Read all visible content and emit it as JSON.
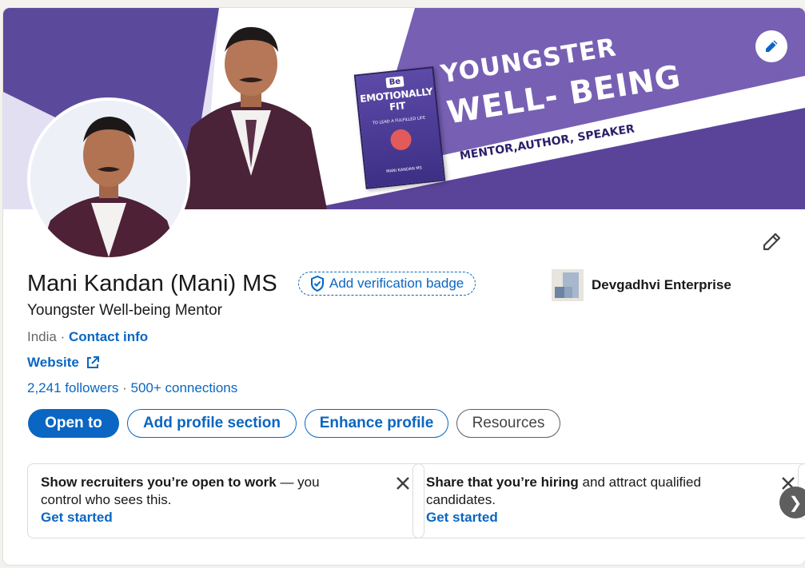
{
  "banner": {
    "title_line1": "YOUNGSTER",
    "title_line2": "WELL- BEING",
    "subtitle": "MENTOR,AUTHOR, SPEAKER",
    "book": {
      "be": "Be",
      "title": "EMOTIONALLY FIT",
      "tagline": "TO LEAD A FULFILLED LIFE",
      "author": "MANI KANDAN MS"
    }
  },
  "profile": {
    "name": "Mani Kandan (Mani) MS",
    "verification_label": "Add verification badge",
    "headline": "Youngster Well-being Mentor",
    "location": "India",
    "separator": "·",
    "contact_info": "Contact info",
    "website": "Website",
    "followers": "2,241 followers",
    "connections": "500+ connections",
    "company": "Devgadhvi Enterprise"
  },
  "actions": {
    "open_to": "Open to",
    "add_section": "Add profile section",
    "enhance": "Enhance profile",
    "resources": "Resources"
  },
  "tips": [
    {
      "bold": "Show recruiters you’re open to work",
      "rest": " — you control who sees this.",
      "cta": "Get started"
    },
    {
      "bold": "Share that you’re hiring",
      "rest": " and attract qualified candidates.",
      "cta": "Get started"
    }
  ],
  "icons": {
    "edit_cover": "pencil-icon",
    "edit_intro": "pencil-icon",
    "verify": "shield-check-icon",
    "external": "external-link-icon",
    "close": "close-icon",
    "next": "chevron-right-icon"
  },
  "colors": {
    "accent": "#0a66c2",
    "banner_purple": "#5a449a",
    "text": "#191919",
    "muted": "#666666"
  },
  "next_glyph": "❯"
}
